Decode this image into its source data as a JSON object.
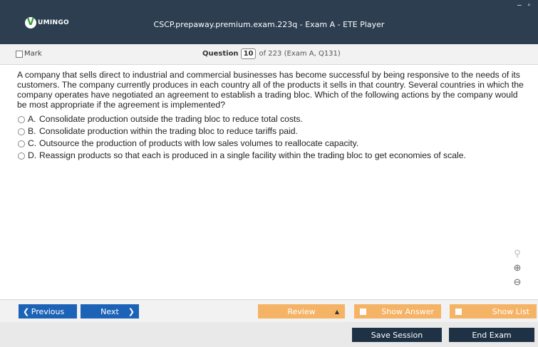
{
  "window": {
    "title": "CSCP.prepaway.premium.exam.223q - Exam A - ETE Player",
    "logo_text": "UMINGO",
    "logo_mark": "V",
    "controls": "– ▫"
  },
  "question_bar": {
    "mark_label": "Mark",
    "question_label": "Question",
    "question_number": "10",
    "of_text": "of 223 (Exam A, Q131)"
  },
  "question": {
    "text": "A company that sells direct to industrial and commercial businesses has become successful by being responsive to the needs of its customers. The company currently produces in each country all of the products it sells in that country. Several countries in which the company operates have negotiated an agreement to establish a trading bloc. Which of the following actions by the company would be most appropriate if the agreement is implemented?",
    "options": [
      {
        "letter": "A.",
        "text": "Consolidate production outside the trading bloc to reduce total costs."
      },
      {
        "letter": "B.",
        "text": "Consolidate production within the trading bloc to reduce tariffs paid."
      },
      {
        "letter": "C.",
        "text": "Outsource the production of products with low sales volumes to reallocate capacity."
      },
      {
        "letter": "D.",
        "text": "Reassign products so that each is produced in a single facility within the trading bloc to get economies of scale."
      }
    ]
  },
  "zoom": {
    "search_icon": "⚲",
    "zoom_in_icon": "⊕",
    "zoom_out_icon": "⊖"
  },
  "nav": {
    "previous_label": "Previous",
    "next_label": "Next",
    "review_label": "Review",
    "show_answer_label": "Show Answer",
    "show_list_label": "Show List",
    "save_session_label": "Save Session",
    "end_exam_label": "End Exam"
  },
  "colors": {
    "titlebar": "#2c3e50",
    "nav_blue": "#1c63b7",
    "orange": "#f5b366",
    "dark_button": "#1f3245"
  }
}
